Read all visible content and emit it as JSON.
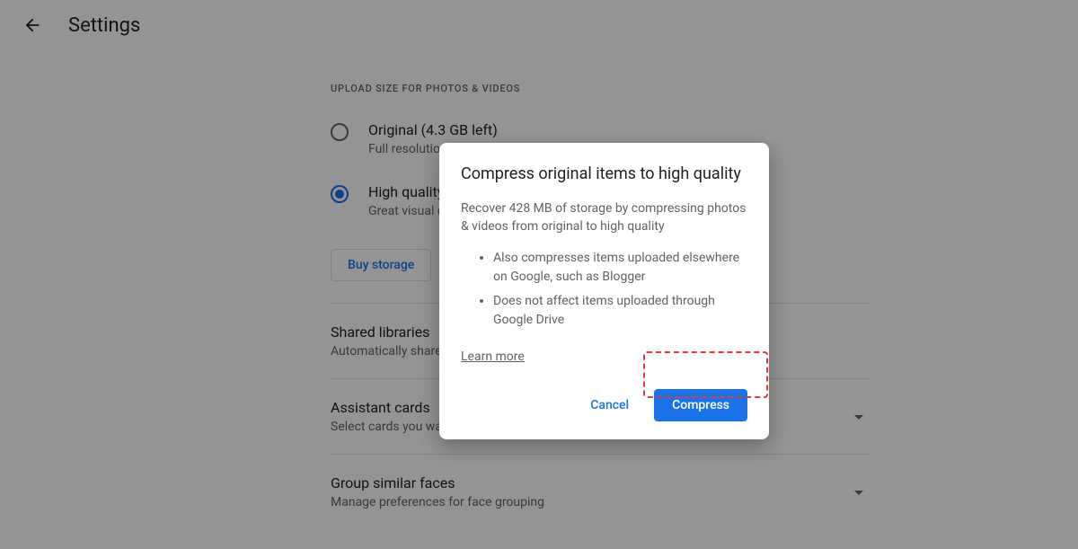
{
  "header": {
    "title": "Settings"
  },
  "upload": {
    "section_label": "UPLOAD SIZE FOR PHOTOS & VIDEOS",
    "options": [
      {
        "title": "Original (4.3 GB left)",
        "subtitle": "Full resolution"
      },
      {
        "title": "High quality",
        "subtitle": "Great visual q"
      }
    ],
    "buy_label": "Buy storage"
  },
  "items": [
    {
      "title": "Shared libraries",
      "subtitle": "Automatically share photos"
    },
    {
      "title": "Assistant cards",
      "subtitle": "Select cards you want to see in your Assistant"
    },
    {
      "title": "Group similar faces",
      "subtitle": "Manage preferences for face grouping"
    }
  ],
  "dialog": {
    "title": "Compress original items to high quality",
    "body": "Recover 428 MB of storage by compressing photos & videos from original to high quality",
    "bullets": [
      "Also compresses items uploaded elsewhere on Google, such as Blogger",
      "Does not affect items uploaded through Google Drive"
    ],
    "learn": "Learn more",
    "cancel": "Cancel",
    "confirm": "Compress"
  }
}
